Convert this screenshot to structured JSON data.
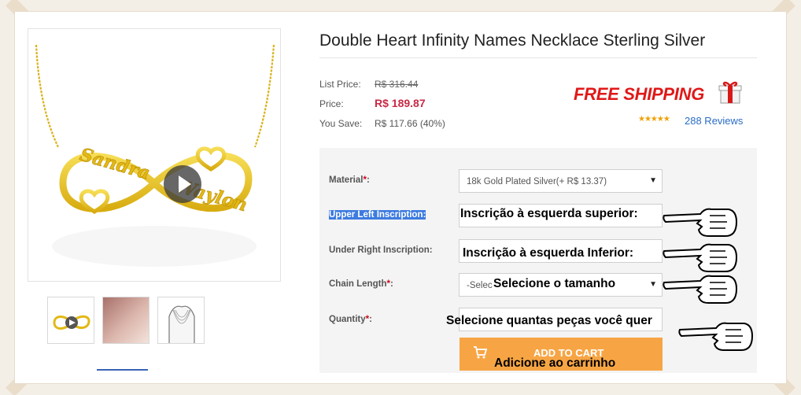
{
  "product": {
    "title": "Double Heart Infinity Names Necklace Sterling Silver",
    "list_price_label": "List Price:",
    "list_price": "R$ 316.44",
    "price_label": "Price:",
    "price": "R$ 189.87",
    "you_save_label": "You Save:",
    "you_save": "R$ 117.66 (40%)"
  },
  "shipping": {
    "text": "FREE SHIPPING"
  },
  "reviews": {
    "stars": "★★★★★",
    "text": "288 Reviews"
  },
  "engraving": {
    "name1": "Sandra",
    "name2": "Waylon"
  },
  "options": {
    "material_label": "Material",
    "material_value": "18k Gold Plated Silver(+ R$ 13.37)",
    "upper_left_label": "Upper Left Inscription:",
    "upper_left_overlay": "Inscrição à esquerda superior:",
    "under_right_label": "Under Right Inscription:",
    "under_right_overlay": "Inscrição à esquerda Inferior:",
    "chain_label": "Chain Length",
    "chain_value": "-Selec",
    "chain_overlay": "Selecione o tamanho",
    "quantity_label": "Quantity",
    "quantity_overlay": "Selecione quantas peças você quer",
    "required_mark": "*",
    "colon": ":"
  },
  "cart": {
    "label": "ADD TO CART",
    "overlay": "Adicione ao carrinho"
  },
  "colors": {
    "price_red": "#c82a45",
    "shipping_red": "#e01818",
    "link_blue": "#2a6dc7",
    "cart_orange": "#f7a544",
    "highlight_blue": "#3d7be0",
    "gold": "#e8c21c"
  },
  "icons": [
    "play-icon",
    "gift-icon",
    "cart-icon",
    "caret-down-icon",
    "pointing-hand-icon"
  ]
}
